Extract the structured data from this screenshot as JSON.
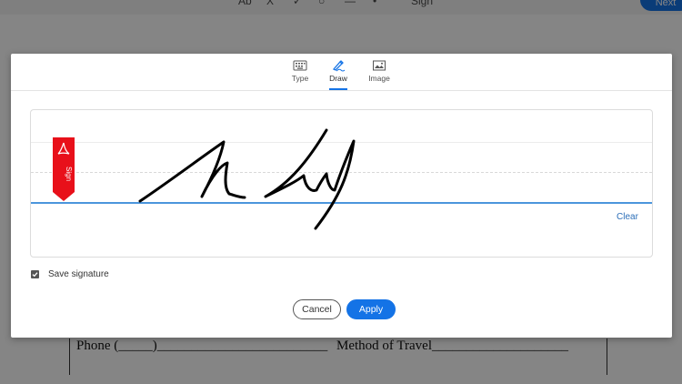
{
  "background": {
    "toolbar": {
      "tools": [
        {
          "name": "text",
          "glyph": "Ab"
        },
        {
          "name": "cross",
          "glyph": "X"
        },
        {
          "name": "check",
          "glyph": "✓"
        },
        {
          "name": "circle",
          "glyph": "○"
        },
        {
          "name": "line",
          "glyph": "—"
        },
        {
          "name": "dot",
          "glyph": "•"
        }
      ],
      "sign_label": "Sign",
      "next_label": "Next"
    },
    "document": {
      "phone_text": "Phone (_____)_________________________",
      "travel_text": "Method of Travel____________________"
    }
  },
  "modal": {
    "tabs": [
      {
        "label": "Type",
        "icon": "keyboard-icon"
      },
      {
        "label": "Draw",
        "icon": "pen-icon"
      },
      {
        "label": "Image",
        "icon": "image-icon"
      }
    ],
    "active_tab": "Draw",
    "sign_flag_label": "Sign",
    "clear_label": "Clear",
    "save_signature": {
      "label": "Save signature",
      "checked": true
    },
    "cancel_label": "Cancel",
    "apply_label": "Apply",
    "colors": {
      "accent": "#1473e6",
      "flag": "#e8101a",
      "baseline": "#4b95dc"
    }
  }
}
